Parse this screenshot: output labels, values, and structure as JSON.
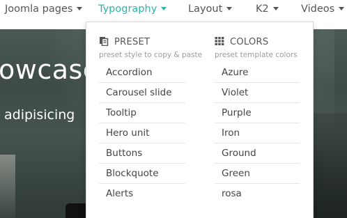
{
  "nav": {
    "items": [
      {
        "label": "Joomla pages",
        "active": false
      },
      {
        "label": "Typography",
        "active": true
      },
      {
        "label": "Layout",
        "active": false
      },
      {
        "label": "K2",
        "active": false
      },
      {
        "label": "Videos",
        "active": false
      }
    ]
  },
  "hero": {
    "title": "owcase y",
    "subtitle": "adipisicing"
  },
  "dropdown": {
    "preset": {
      "heading": "PRESET",
      "description": "preset style to copy & paste",
      "icon": "copy-icon",
      "items": [
        "Accordion",
        "Carousel slide",
        "Tooltip",
        "Hero unit",
        "Buttons",
        "Blockquote",
        "Alerts"
      ]
    },
    "colors": {
      "heading": "COLORS",
      "description": "preset template colors",
      "icon": "grid-icon",
      "items": [
        "Azure",
        "Violet",
        "Purple",
        "Iron",
        "Ground",
        "Green",
        "rosa"
      ]
    }
  },
  "theme": {
    "accent": "#2cb5a8",
    "nav_text": "#555555",
    "hero_dark": "#3d4a48"
  }
}
